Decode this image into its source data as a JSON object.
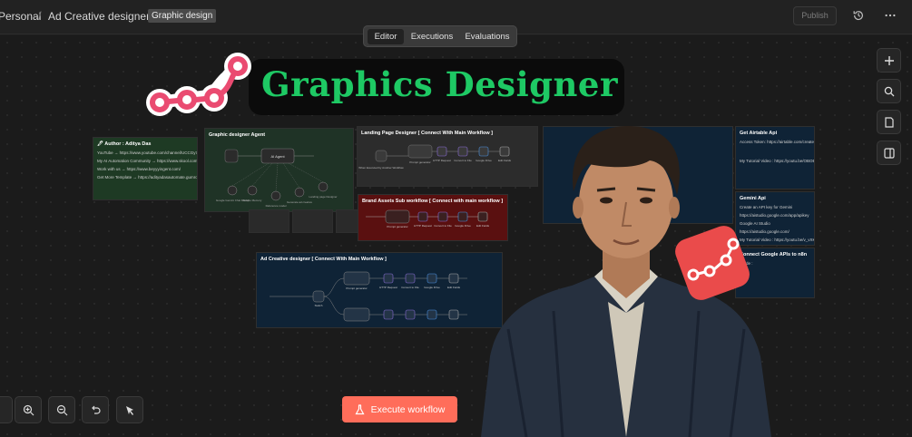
{
  "header": {
    "workspace": "Personal",
    "workflow_name": "Ad Creative designer",
    "tag": "Graphic design",
    "publish_label": "Publish"
  },
  "tabs": [
    {
      "label": "Editor",
      "active": true
    },
    {
      "label": "Executions",
      "active": false
    },
    {
      "label": "Evaluations",
      "active": false
    }
  ],
  "overlay": {
    "title": "Graphics Designer",
    "title_color": "#1ec964",
    "logo_color": "#ea4b71"
  },
  "canvas": {
    "author_note": {
      "title": "🖊 Author : Aditya Das",
      "lines": [
        "YouTube → https://www.youtube.com/channel/UCCGy7r4dCK_EFWH-Yzbsfg",
        "My AI Automation Community → https://www.skool.com/agentic-agents-1677",
        "Work with us → https://www.beyyyingent.com/",
        "Get More Template → https://adityadasautomate.gumroad.com/"
      ]
    },
    "agent_group": {
      "title": "Graphic designer Agent",
      "node": "AI Agent",
      "subnodes": [
        "Google Gemini Chat Model",
        "Simple Memory",
        "Reference model",
        "Generate ad creative",
        "Landing page Designer"
      ]
    },
    "landing_group": {
      "title": "Landing Page Designer [ Connect With Main Workflow ]",
      "trigger": "When Executed by Another Workflow",
      "nodes": [
        "Prompt generator",
        "HTTP Request",
        "Convert to File",
        "Google Drive",
        "Edit Fields"
      ]
    },
    "brand_group": {
      "title": "Brand Assets Sub workflow [ Connect with main workflow ]",
      "nodes": [
        "Prompt generator",
        "HTTP Request",
        "Convert to File",
        "Google Drive",
        "Edit Fields"
      ]
    },
    "ad_group": {
      "title": "Ad Creative designer [ Connect With Main Workflow ]",
      "router": "Switch",
      "nodes": [
        "Prompt generator",
        "HTTP Request",
        "Convert to File",
        "Google Drive",
        "Edit Fields"
      ]
    },
    "api_notes": {
      "airtable": {
        "title": "Get Airtable Api",
        "lines": [
          "Access Token: https://airtable.com/create/tokens",
          "My Tutorial Video : https://youtu.be/OBOBTzr3ooA1"
        ]
      },
      "gemini": {
        "title": "Gemini Api",
        "lines": [
          "Create an API key for Gemini",
          "https://aistudio.google.com/app/apikey",
          "Google AI Studio",
          "https://aistudio.google.com/",
          "My Tutorial Video : https://youtu.be/v_vXKY8UKHE"
        ]
      },
      "google": {
        "title": "Connect Google APIs to n8n",
        "lines": [
          "Guide :"
        ]
      }
    }
  },
  "controls": {
    "execute_label": "Execute workflow"
  }
}
